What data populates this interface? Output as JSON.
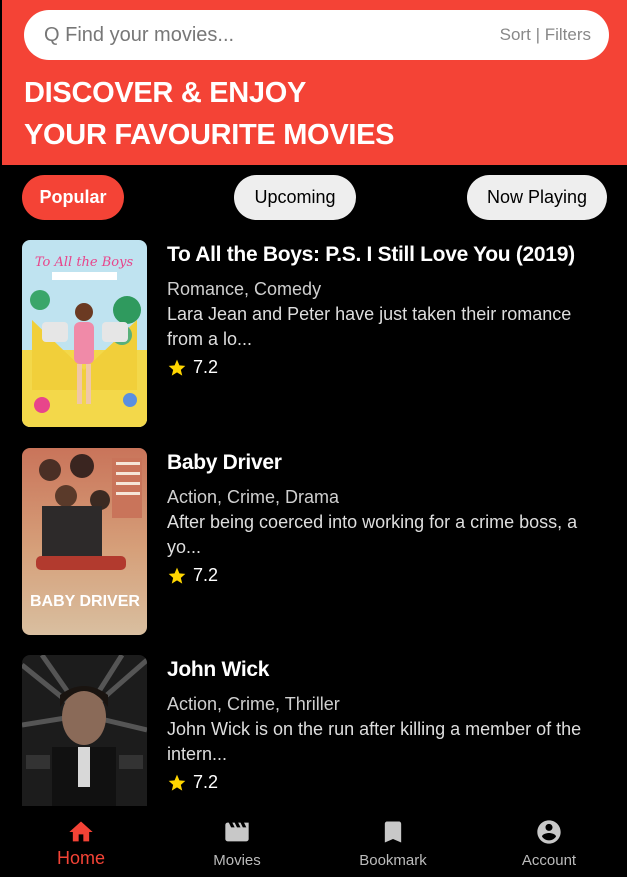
{
  "search": {
    "placeholder": "Q Find your movies...",
    "sort_label": "Sort",
    "separator": "|",
    "filters_label": "Filters"
  },
  "hero": {
    "line1": "DISCOVER & ENJOY",
    "line2": "YOUR FAVOURITE MOVIES"
  },
  "tabs": [
    {
      "label": "Popular",
      "active": true
    },
    {
      "label": "Upcoming",
      "active": false
    },
    {
      "label": "Now Playing",
      "active": false
    }
  ],
  "movies": [
    {
      "title": "To All the Boys: P.S. I Still Love You (2019)",
      "genres": "Romance, Comedy",
      "overview": "Lara Jean and Peter have just taken their romance from a lo...",
      "rating": "7.2",
      "poster_text": "To All the Boys"
    },
    {
      "title": "Baby Driver",
      "genres": "Action, Crime, Drama",
      "overview": "After being coerced into working for a crime boss, a yo...",
      "rating": "7.2",
      "poster_text": "BABY DRIVER"
    },
    {
      "title": "John Wick",
      "genres": "Action, Crime, Thriller",
      "overview": "John Wick is on the run after killing a member of the intern...",
      "rating": "7.2",
      "poster_text": ""
    }
  ],
  "bottom_nav": [
    {
      "label": "Home",
      "icon": "home-icon",
      "active": true
    },
    {
      "label": "Movies",
      "icon": "movie-clapper-icon",
      "active": false
    },
    {
      "label": "Bookmark",
      "icon": "bookmark-icon",
      "active": false
    },
    {
      "label": "Account",
      "icon": "account-circle-icon",
      "active": false
    }
  ],
  "colors": {
    "accent": "#f44336",
    "background": "#000000",
    "star": "#ffd600"
  }
}
